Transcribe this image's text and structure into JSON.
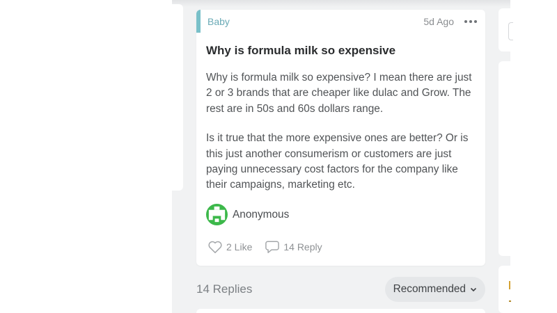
{
  "post": {
    "category": "Baby",
    "time": "5d Ago",
    "title": "Why is formula milk so expensive",
    "body": [
      "Why is formula milk so expensive? I mean there are just 2 or 3 brands that are cheaper like dulac and Grow. The rest are in 50s and 60s dollars range.",
      "Is it true that the more expensive ones are better? Or is this just another consumerism or customers are just paying unnecessary cost factors for the company like their campaigns, marketing etc."
    ],
    "author": "Anonymous",
    "like_label": "2 Like",
    "reply_label": "14 Reply",
    "accent_color": "#79c0c9",
    "avatar_color": "#3cb84a",
    "icons": {
      "more": "more-horizontal-icon",
      "like": "heart-outline-icon",
      "reply": "comment-bubble-icon"
    }
  },
  "replies": {
    "count_label": "14 Replies",
    "sort_label": "Recommended",
    "sort_icon": "chevron-down-icon"
  }
}
